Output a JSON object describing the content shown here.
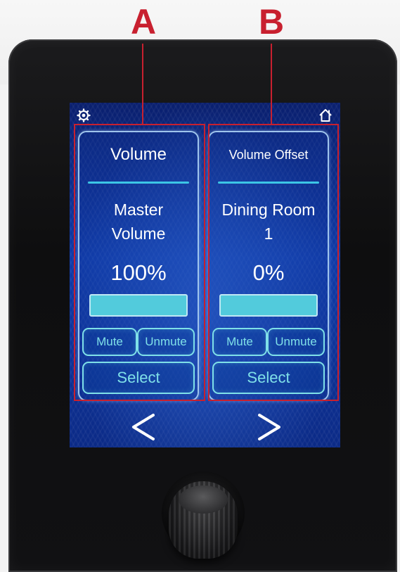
{
  "callouts": {
    "a": "A",
    "b": "B"
  },
  "colors": {
    "callout": "#c8202f",
    "accent": "#3cc6e6",
    "button": "#7fe0e8"
  },
  "topbar": {
    "left_icon": "gear-icon",
    "right_icon": "home-icon"
  },
  "panels": [
    {
      "title": "Volume",
      "name_line1": "Master",
      "name_line2": "Volume",
      "value": "100%",
      "level_percent": 100,
      "mute_label": "Mute",
      "unmute_label": "Unmute",
      "select_label": "Select"
    },
    {
      "title": "Volume Offset",
      "name_line1": "Dining Room",
      "name_line2": "1",
      "value": "0%",
      "level_percent": 0,
      "mute_label": "Mute",
      "unmute_label": "Unmute",
      "select_label": "Select"
    }
  ],
  "nav": {
    "prev_icon": "chevron-left-icon",
    "next_icon": "chevron-right-icon"
  }
}
